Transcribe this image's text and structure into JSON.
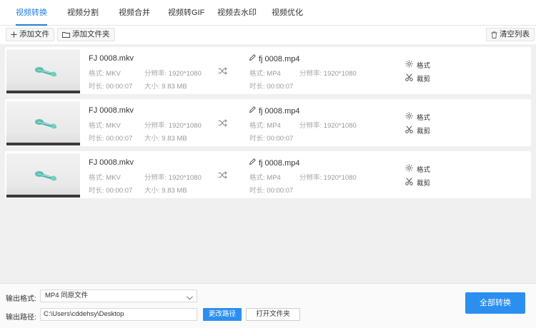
{
  "tabs": [
    {
      "label": "视频转换",
      "active": true
    },
    {
      "label": "视频分割",
      "active": false
    },
    {
      "label": "视频合并",
      "active": false
    },
    {
      "label": "视频转GIF",
      "active": false
    },
    {
      "label": "视频去水印",
      "active": false
    },
    {
      "label": "视频优化",
      "active": false
    }
  ],
  "toolbar": {
    "add_file": "添加文件",
    "add_folder": "添加文件夹",
    "clear_list": "清空列表"
  },
  "labels": {
    "format": "格式:",
    "resolution": "分辨率:",
    "duration": "时长:",
    "size": "大小:",
    "settings_action": "格式",
    "trim_action": "裁剪"
  },
  "files": [
    {
      "source": {
        "name": "FJ 0008.mkv",
        "format": "MKV",
        "resolution": "1920*1080",
        "duration": "00:00:07",
        "size": "9.83 MB"
      },
      "output": {
        "name": "fj 0008.mp4",
        "format": "MP4",
        "resolution": "1920*1080",
        "duration": "00:00:07"
      }
    },
    {
      "source": {
        "name": "FJ 0008.mkv",
        "format": "MKV",
        "resolution": "1920*1080",
        "duration": "00:00:07",
        "size": "9.83 MB"
      },
      "output": {
        "name": "fj 0008.mp4",
        "format": "MP4",
        "resolution": "1920*1080",
        "duration": "00:00:07"
      }
    },
    {
      "source": {
        "name": "FJ 0008.mkv",
        "format": "MKV",
        "resolution": "1920*1080",
        "duration": "00:00:07",
        "size": "9.83 MB"
      },
      "output": {
        "name": "fj 0008.mp4",
        "format": "MP4",
        "resolution": "1920*1080",
        "duration": "00:00:07"
      }
    }
  ],
  "bottom": {
    "output_format_label": "输出格式:",
    "output_format_value": "MP4  同原文件",
    "output_path_label": "输出路径:",
    "output_path_value": "C:\\Users\\cddehsy\\Desktop",
    "change_path": "更改路径",
    "open_folder": "打开文件夹",
    "convert_all": "全部转换"
  },
  "colors": {
    "accent": "#2b8ff0",
    "tab_active": "#1e7fe0"
  }
}
